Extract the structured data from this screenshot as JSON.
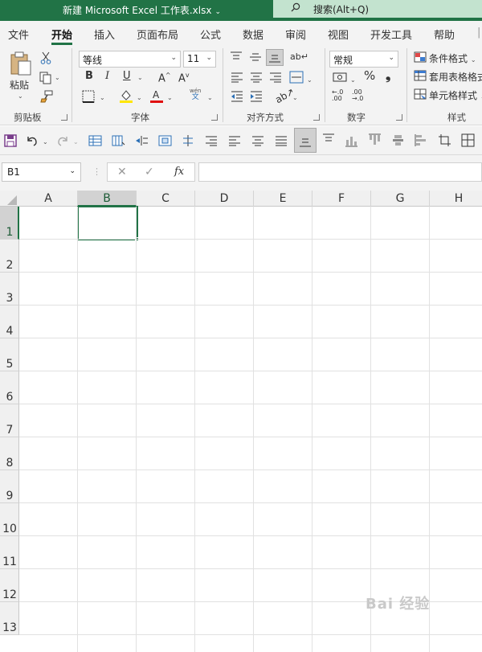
{
  "window": {
    "title": "新建 Microsoft Excel 工作表.xlsx",
    "title_caret": "⌄",
    "search_placeholder": "搜索(Alt+Q)"
  },
  "tabs": [
    {
      "label": "文件"
    },
    {
      "label": "开始",
      "active": true
    },
    {
      "label": "插入"
    },
    {
      "label": "页面布局"
    },
    {
      "label": "公式"
    },
    {
      "label": "数据"
    },
    {
      "label": "审阅"
    },
    {
      "label": "视图"
    },
    {
      "label": "开发工具"
    },
    {
      "label": "帮助"
    }
  ],
  "ribbon": {
    "clipboard": {
      "label": "剪贴板",
      "paste": "粘贴"
    },
    "font": {
      "label": "字体",
      "font_name": "等线",
      "font_size": "11",
      "bold": "B",
      "italic": "I",
      "underline": "U",
      "wen": "wén",
      "wen2": "文"
    },
    "alignment": {
      "label": "对齐方式"
    },
    "number": {
      "label": "数字",
      "format": "常规",
      "percent": "%",
      "comma": "❟",
      "inc_dec": "←.0 .00",
      "dec_dec": ".00 →.0"
    },
    "styles": {
      "label": "样式",
      "conditional": "条件格式",
      "table": "套用表格格式",
      "cell": "单元格样式"
    }
  },
  "formula_bar": {
    "name_box": "B1",
    "cancel": "✕",
    "enter": "✓",
    "fx": "fx",
    "value": ""
  },
  "sheet": {
    "columns": [
      "A",
      "B",
      "C",
      "D",
      "E",
      "F",
      "G",
      "H"
    ],
    "rows": [
      "1",
      "2",
      "3",
      "4",
      "5",
      "6",
      "7",
      "8",
      "9",
      "10",
      "11",
      "12",
      "13"
    ],
    "selected_cell": "B1"
  },
  "watermark": "Bai 经验",
  "colors": {
    "accent": "#217346",
    "title_bg": "#217346",
    "search_bg": "#c3e3cf",
    "ribbon_bg": "#f3f3f3"
  }
}
